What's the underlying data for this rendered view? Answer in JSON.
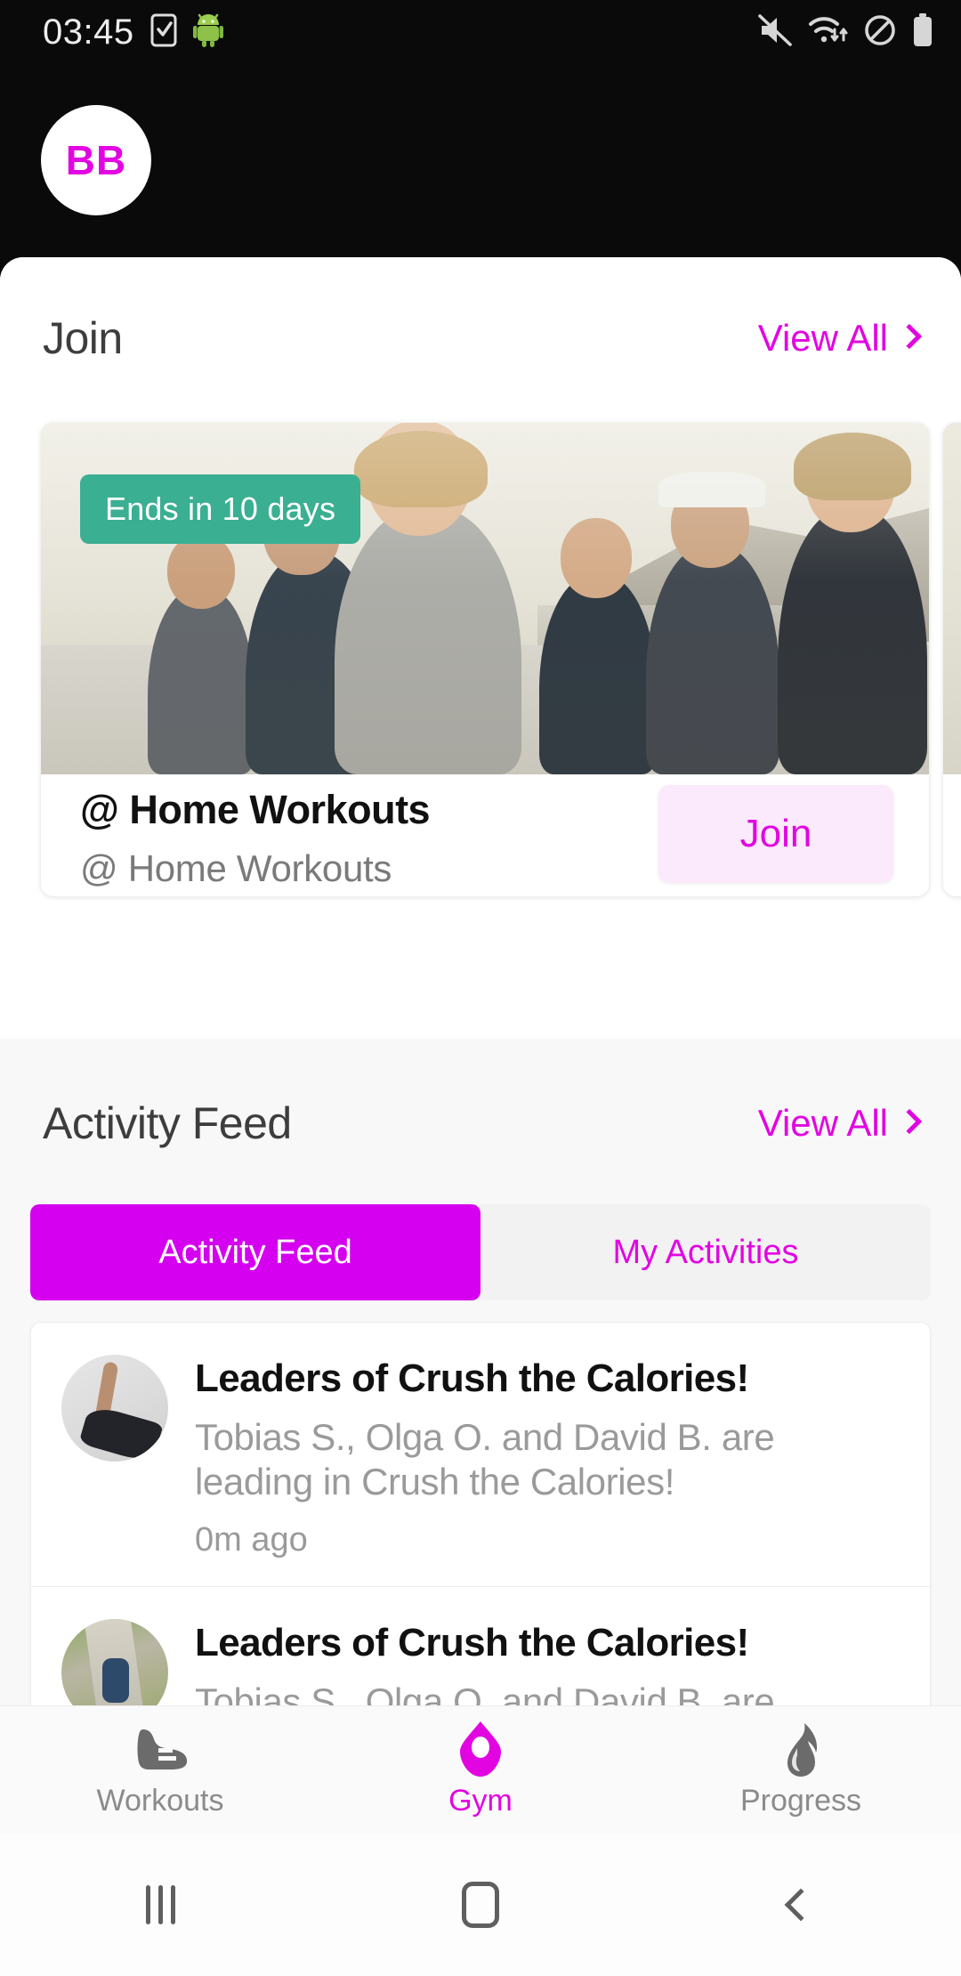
{
  "status_bar": {
    "time": "03:45",
    "left_icons": [
      "sim-card-check-icon",
      "android-robot-icon"
    ],
    "right_icons": [
      "volume-mute-icon",
      "wifi-data-icon",
      "do-not-disturb-icon",
      "battery-icon"
    ]
  },
  "header": {
    "avatar_initials": "BB"
  },
  "join_section": {
    "title": "Join",
    "view_all": "View All",
    "cards": [
      {
        "badge": "Ends in 10 days",
        "title": "@ Home Workouts",
        "subtitle": "@ Home Workouts",
        "action": "Join"
      }
    ]
  },
  "activity_section": {
    "title": "Activity Feed",
    "view_all": "View All",
    "tabs": [
      {
        "label": "Activity Feed",
        "active": true
      },
      {
        "label": "My Activities",
        "active": false
      }
    ],
    "items": [
      {
        "title": "Leaders of Crush the Calories!",
        "description": "Tobias S., Olga O. and David B. are leading in Crush the Calories!",
        "time": "0m ago",
        "thumbnail": "yoga-pose-photo"
      },
      {
        "title": "Leaders of Crush the Calories!",
        "description": "Tobias S., Olga O. and David B. are",
        "time": "",
        "thumbnail": "runners-photo"
      }
    ]
  },
  "bottom_nav": {
    "items": [
      {
        "label": "Workouts",
        "icon": "shoe-icon",
        "active": false
      },
      {
        "label": "Gym",
        "icon": "gym-marker-icon",
        "active": true
      },
      {
        "label": "Progress",
        "icon": "flame-icon",
        "active": false
      }
    ]
  },
  "system_nav": {
    "recents": "recents-icon",
    "home": "home-icon",
    "back": "back-icon"
  },
  "colors": {
    "accent": "#e205e2",
    "accent_tab": "#d500f0",
    "badge_green": "#3aaf92",
    "join_button_bg": "#fbeafb",
    "sheet_bg": "#f8f8f8"
  }
}
